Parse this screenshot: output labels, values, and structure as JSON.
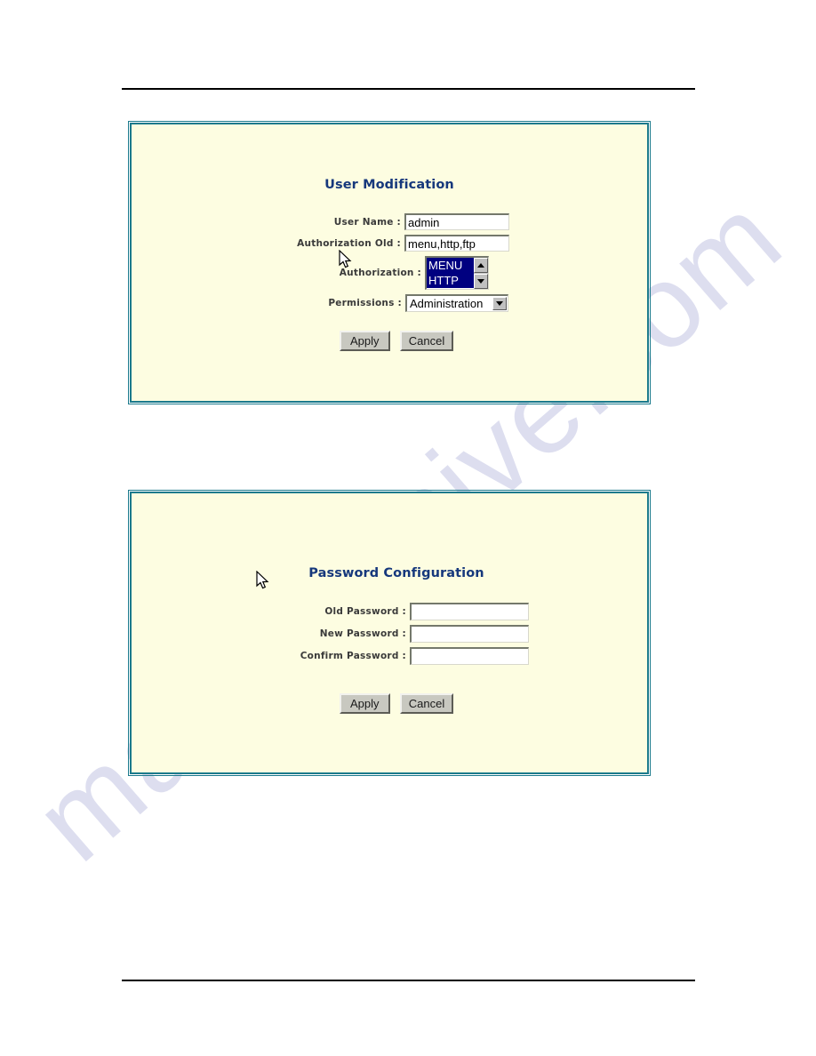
{
  "document": {
    "watermark": "manualshive.com",
    "header_rule": true,
    "footer_rule": true
  },
  "theme": {
    "panel_background": "#fdfde1",
    "panel_border": "#1b7a8c",
    "title_color": "#16387c",
    "label_color": "#3a3a3a",
    "selection_background": "#000080",
    "selection_text": "#ffffff",
    "button_face": "#c8c8c0",
    "watermark_color": "#c9cbe6"
  },
  "panels": [
    {
      "id": "user-modification",
      "title": "User Modification",
      "fields": [
        {
          "label": "User Name :",
          "value": "admin"
        },
        {
          "label": "Authorization Old :",
          "value": "menu,http,ftp"
        }
      ],
      "authorization": {
        "label": "Authorization :",
        "options": [
          {
            "text": "MENU",
            "selected": true
          },
          {
            "text": "HTTP",
            "selected": true
          }
        ],
        "scroll_up_icon": "triangle-up-icon",
        "scroll_down_icon": "triangle-down-icon"
      },
      "permissions": {
        "label": "Permissions :",
        "value": "Administration",
        "caret_icon": "chevron-down-icon"
      },
      "buttons": {
        "apply": "Apply",
        "cancel": "Cancel"
      },
      "cursor_icon": "mouse-pointer-icon"
    },
    {
      "id": "password-configuration",
      "title": "Password Configuration",
      "fields": [
        {
          "label": "Old Password :",
          "value": ""
        },
        {
          "label": "New Password :",
          "value": ""
        },
        {
          "label": "Confirm Password :",
          "value": ""
        }
      ],
      "buttons": {
        "apply": "Apply",
        "cancel": "Cancel"
      },
      "cursor_icon": "mouse-pointer-icon"
    }
  ]
}
